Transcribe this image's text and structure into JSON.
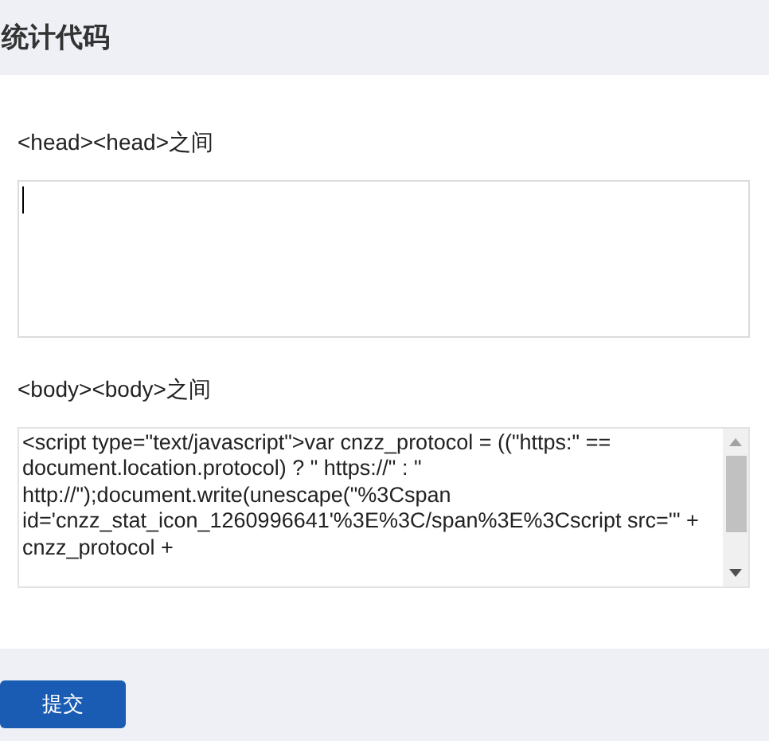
{
  "header": {
    "title": "统计代码"
  },
  "fields": [
    {
      "label": "<head><head>之间",
      "focused": true
    },
    {
      "label": "<body><body>之间",
      "value": "<script type=\"text/javascript\">var cnzz_protocol = ((\"https:\" == document.location.protocol) ? \" https://\" : \" http://\");document.write(unescape(\"%3Cspan id='cnzz_stat_icon_1260996641'%3E%3C/span%3E%3Cscript src='\" + cnzz_protocol +",
      "focused": false
    }
  ],
  "submit": {
    "label": "提交"
  }
}
